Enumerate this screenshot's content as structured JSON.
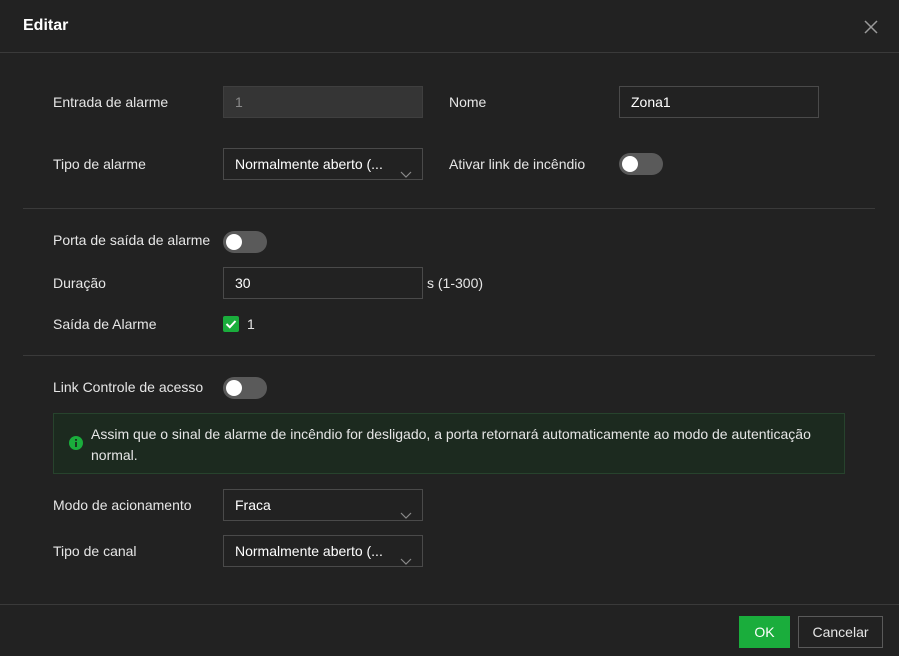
{
  "dialog": {
    "title": "Editar"
  },
  "alarm_input": {
    "label": "Entrada de alarme",
    "value": "1"
  },
  "name": {
    "label": "Nome",
    "value": "Zona1"
  },
  "alarm_type": {
    "label": "Tipo de alarme",
    "selected": "Normalmente aberto (..."
  },
  "fire_link": {
    "label": "Ativar link de incêndio",
    "enabled": false
  },
  "alarm_output_port": {
    "label": "Porta de saída de alarme",
    "enabled": false
  },
  "duration": {
    "label": "Duração",
    "value": "30",
    "unit_hint": "s (1-300)"
  },
  "alarm_output": {
    "label": "Saída de Alarme",
    "checkbox_label": "1",
    "checked": true
  },
  "access_control_link": {
    "label": "Link Controle de acesso",
    "enabled": false
  },
  "notice": {
    "text": "Assim que o sinal de alarme de incêndio for desligado, a porta retornará automaticamente ao modo de autenticação normal."
  },
  "trigger_mode": {
    "label": "Modo de acionamento",
    "selected": "Fraca"
  },
  "channel_type": {
    "label": "Tipo de canal",
    "selected": "Normalmente aberto (..."
  },
  "buttons": {
    "ok": "OK",
    "cancel": "Cancelar"
  },
  "colors": {
    "accent": "#1aad3c",
    "background": "#222222",
    "toggle_off": "#5a5a5a"
  },
  "icons": {
    "close": "close-icon",
    "chevron": "chevron-down-icon",
    "check": "check-icon",
    "info": "info-icon"
  }
}
